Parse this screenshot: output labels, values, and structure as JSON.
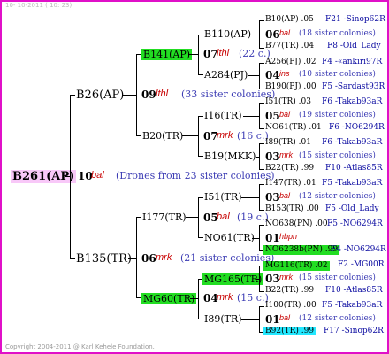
{
  "header": "10- 10-2011 ( 10: 23)",
  "footer": "Copyright 2004-2011 @ Karl Kehele Foundation.",
  "root": {
    "id": "B261(AP)",
    "gen": "10",
    "fam": "bal",
    "note": "(Drones from 23 sister colonies)"
  },
  "l1": [
    {
      "id": "B26(AP)",
      "gen": "09",
      "fam": "lthl",
      "note": "(33 sister colonies)"
    },
    {
      "id": "B135(TR)",
      "gen": "06",
      "fam": "mrk",
      "note": "(21 sister colonies)"
    }
  ],
  "l2": [
    {
      "id": "B141(AP)",
      "gen": "07",
      "fam": "lthl",
      "note": "(22 c.)"
    },
    {
      "id": "B20(TR)",
      "gen": "07",
      "fam": "mrk",
      "note": "(16 c.)"
    },
    {
      "id": "I177(TR)",
      "gen": "05",
      "fam": "bal",
      "note": "(19 c.)"
    },
    {
      "id": "MG60(TR)",
      "gen": "04",
      "fam": "mrk",
      "note": "(15 c.)"
    }
  ],
  "l3": [
    "B110(AP)",
    "A284(PJ)",
    "I16(TR)",
    "B19(MKK)",
    "I51(TR)",
    "NO61(TR)",
    "MG165(TR)",
    "I89(TR)"
  ],
  "l4": [
    {
      "top": "B10(AP) .05",
      "topr": "F21 -Sinop62R",
      "gen": "06",
      "fam": "bal",
      "note": "(18 sister colonies)",
      "bot": "B77(TR) .04",
      "botr": "F8 -Old_Lady"
    },
    {
      "top": "A256(PJ) .02",
      "topr": "F4 -«ankiri97R",
      "gen": "04",
      "fam": "ins",
      "note": "(10 sister colonies)",
      "bot": "B190(PJ) .00",
      "botr": "F5 -Sardast93R"
    },
    {
      "top": "I51(TR) .03",
      "topr": "F6 -Takab93aR",
      "gen": "05",
      "fam": "bal",
      "note": "(19 sister colonies)",
      "bot": "NO61(TR) .01",
      "botr": "F6 -NO6294R"
    },
    {
      "top": "I89(TR) .01",
      "topr": "F6 -Takab93aR",
      "gen": "03",
      "fam": "mrk",
      "note": "(15 sister colonies)",
      "bot": "B22(TR) .99",
      "botr": "F10 -Atlas85R"
    },
    {
      "top": "I147(TR) .01",
      "topr": "F5 -Takab93aR",
      "gen": "03",
      "fam": "bal",
      "note": "(12 sister colonies)",
      "bot": "B153(TR) .00",
      "botr": "F5 -Old_Lady"
    },
    {
      "top": "NO638(PN) .00",
      "topr": "F5 -NO6294R",
      "gen": "01",
      "fam": "hbpn",
      "note": "",
      "bot": "NO6238b(PN) .99",
      "botr": "F4 -NO6294R"
    },
    {
      "top": "MG116(TR) .02",
      "topr": "F2 -MG00R",
      "gen": "03",
      "fam": "mrk",
      "note": "(15 sister colonies)",
      "bot": "B22(TR) .99",
      "botr": "F10 -Atlas85R"
    },
    {
      "top": "I100(TR) .00",
      "topr": "F5 -Takab93aR",
      "gen": "01",
      "fam": "bal",
      "note": "(12 sister colonies)",
      "bot": "B92(TR) .99",
      "botr": "F17 -Sinop62R"
    }
  ]
}
